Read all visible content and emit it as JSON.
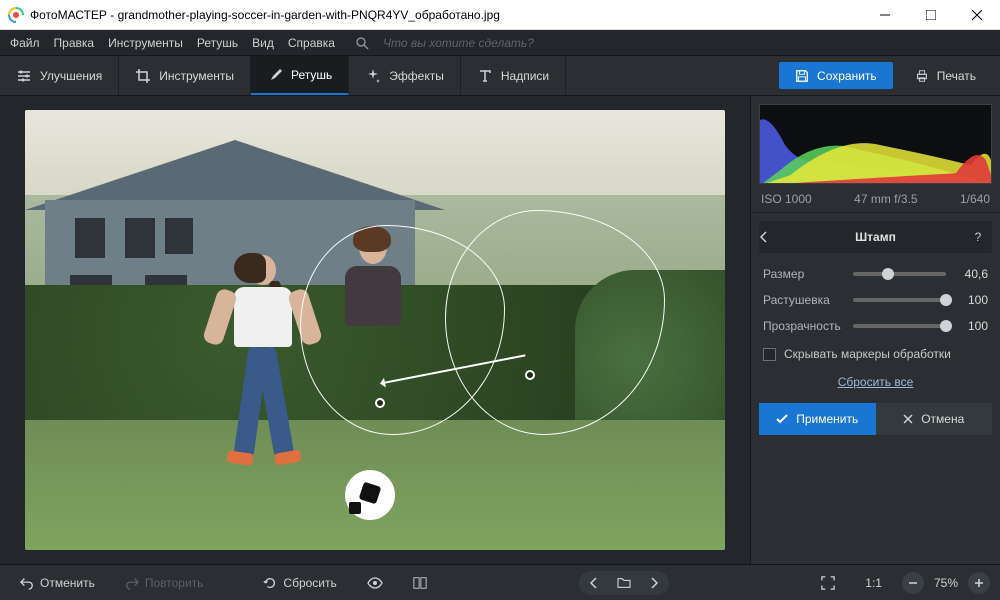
{
  "window": {
    "app_name": "ФотоМАСТЕР",
    "file_name": "grandmother-playing-soccer-in-garden-with-PNQR4YV_обработано.jpg",
    "title_sep": " - "
  },
  "menu": {
    "file": "Файл",
    "edit": "Правка",
    "tools": "Инструменты",
    "retouch": "Ретушь",
    "view": "Вид",
    "help": "Справка",
    "search_placeholder": "Что вы хотите сделать?"
  },
  "tabs": {
    "enhance": "Улучшения",
    "tools": "Инструменты",
    "retouch": "Ретушь",
    "effects": "Эффекты",
    "text": "Надписи",
    "active": "retouch"
  },
  "actions": {
    "save": "Сохранить",
    "print": "Печать"
  },
  "exif": {
    "iso": "ISO 1000",
    "lens": "47 mm f/3.5",
    "shutter": "1/640"
  },
  "panel": {
    "title": "Штамп",
    "size_label": "Размер",
    "size_value": "40,6",
    "size_pct": 38,
    "feather_label": "Растушевка",
    "feather_value": "100",
    "feather_pct": 100,
    "opacity_label": "Прозрачность",
    "opacity_value": "100",
    "opacity_pct": 100,
    "hide_markers": "Скрывать маркеры обработки",
    "reset_all": "Сбросить все",
    "apply": "Применить",
    "cancel": "Отмена"
  },
  "footer": {
    "undo": "Отменить",
    "redo": "Повторить",
    "reset": "Сбросить",
    "ratio": "1:1",
    "zoom": "75%"
  }
}
